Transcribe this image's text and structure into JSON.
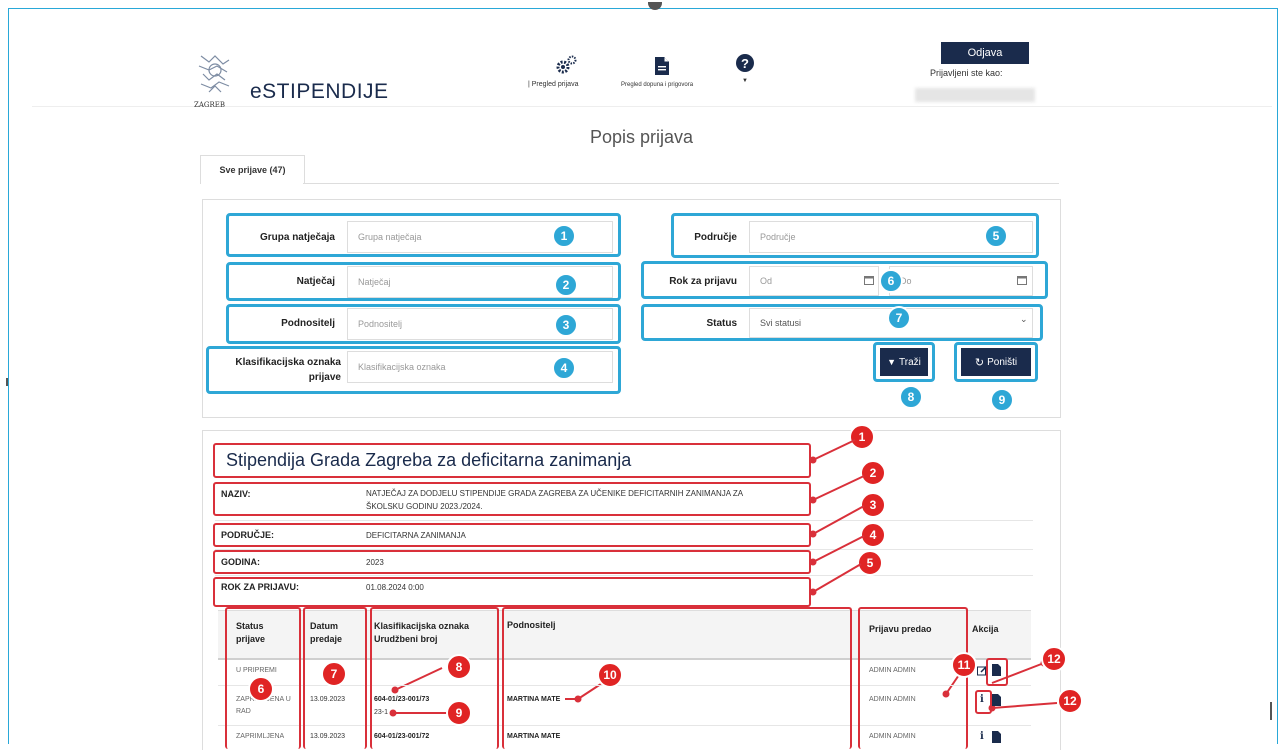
{
  "header": {
    "logo_text": "ZAGREB",
    "brand": "eSTIPENDIJE",
    "nav": [
      {
        "label": "Pregled prijava",
        "icon": "gears-icon"
      },
      {
        "label": "Pregled dopuna i prigovora",
        "icon": "document-icon"
      },
      {
        "label": "",
        "icon": "help-icon"
      }
    ],
    "logout_label": "Odjava",
    "logged_in_label": "Prijavljeni ste kao:"
  },
  "page": {
    "title": "Popis prijava",
    "tab_label": "Sve prijave (47)"
  },
  "filters": {
    "grupa_label": "Grupa natječaja",
    "grupa_placeholder": "Grupa natječaja",
    "natjecaj_label": "Natječaj",
    "natjecaj_placeholder": "Natječaj",
    "podnositelj_label": "Podnositelj",
    "podnositelj_placeholder": "Podnositelj",
    "klasif_label": "Klasifikacijska oznaka prijave",
    "klasif_placeholder": "Klasifikacijska oznaka",
    "podrucje_label": "Područje",
    "podrucje_placeholder": "Područje",
    "rok_label": "Rok za prijavu",
    "od_placeholder": "Od",
    "do_placeholder": "Do",
    "status_label": "Status",
    "status_value": "Svi statusi",
    "search_label": "Traži",
    "reset_label": "Poništi"
  },
  "blue_badges": [
    "1",
    "2",
    "3",
    "4",
    "5",
    "6",
    "7",
    "8",
    "9"
  ],
  "detail": {
    "title": "Stipendija Grada Zagreba za deficitarna zanimanja",
    "naziv_label": "NAZIV:",
    "naziv_value_1": "NATJEČAJ ZA DODJELU STIPENDIJE GRADA ZAGREBA ZA UČENIKE DEFICITARNIH ZANIMANJA ZA",
    "naziv_value_2": "ŠKOLSKU GODINU 2023./2024.",
    "podrucje_label": "PODRUČJE:",
    "podrucje_value": "DEFICITARNA ZANIMANJA",
    "godina_label": "GODINA:",
    "godina_value": "2023",
    "rok_label": "ROK ZA PRIJAVU:",
    "rok_value": "01.08.2024 0:00"
  },
  "table": {
    "headers": {
      "status_1": "Status",
      "status_2": "prijave",
      "datum_1": "Datum",
      "datum_2": "predaje",
      "klas_1": "Klasifikacijska oznaka",
      "klas_2": "Urudžbeni broj",
      "podnositelj": "Podnositelj",
      "predao": "Prijavu predao",
      "akcija": "Akcija"
    },
    "rows": [
      {
        "status": "U PRIPREMI",
        "datum": "",
        "klas": "",
        "urud": "",
        "podnositelj": "",
        "predao": "ADMIN ADMIN"
      },
      {
        "status": "ZAPRIMLJENA U RAD",
        "datum": "13.09.2023",
        "klas": "604-01/23-001/73",
        "urud": "23-1",
        "podnositelj": "MARTINA MATE",
        "predao": "ADMIN ADMIN"
      },
      {
        "status": "ZAPRIMLJENA",
        "datum": "13.09.2023",
        "klas": "604-01/23-001/72",
        "urud": "",
        "podnositelj": "MARTINA MATE",
        "predao": "ADMIN ADMIN"
      }
    ]
  },
  "red_badges": [
    "1",
    "2",
    "3",
    "4",
    "5",
    "6",
    "7",
    "8",
    "9",
    "10",
    "11",
    "12",
    "12"
  ],
  "colors": {
    "brand_dark": "#1a2b4c",
    "highlight_blue": "#2ea7d6",
    "highlight_red": "#d9303a",
    "badge_red": "#e02424"
  }
}
